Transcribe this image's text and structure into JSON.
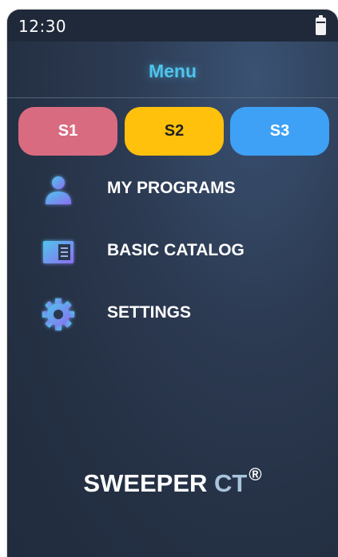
{
  "status_bar": {
    "time": "12:30",
    "battery_icon": "battery-icon"
  },
  "header": {
    "title": "Menu"
  },
  "presets": [
    {
      "label": "S1",
      "color": "#d96b80"
    },
    {
      "label": "S2",
      "color": "#ffc10c"
    },
    {
      "label": "S3",
      "color": "#3ea1f5"
    }
  ],
  "menu": {
    "items": [
      {
        "label": "MY PROGRAMS",
        "icon": "user-icon"
      },
      {
        "label": "BASIC CATALOG",
        "icon": "catalog-icon"
      },
      {
        "label": "SETTINGS",
        "icon": "gear-icon"
      }
    ]
  },
  "brand": {
    "name": "SWEEPER",
    "suffix": "CT",
    "mark": "®"
  },
  "colors": {
    "accent": "#4fc4ec",
    "background": "#243043",
    "status_bar": "#1f2939"
  }
}
